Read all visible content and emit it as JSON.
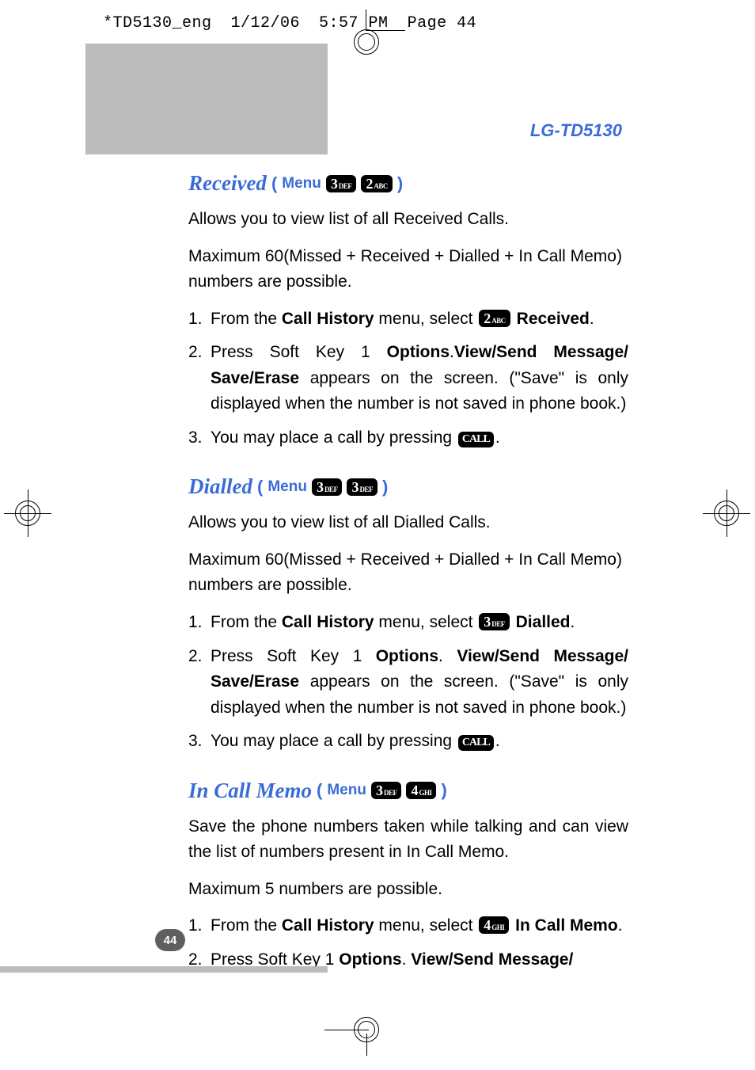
{
  "header": {
    "filename": "*TD5130_eng",
    "date": "1/12/06",
    "time": "5:57 PM",
    "page_label": "Page 44"
  },
  "product": "LG-TD5130",
  "keys": {
    "k2": {
      "num": "2",
      "sub": "ABC"
    },
    "k3": {
      "num": "3",
      "sub": "DEF"
    },
    "k4": {
      "num": "4",
      "sub": "GHI"
    },
    "call": "CALL"
  },
  "menu_word": "Menu",
  "sections": {
    "received": {
      "title": "Received",
      "intro1": "Allows you to view list of all Received Calls.",
      "intro2": "Maximum 60(Missed + Received + Dialled + In Call Memo) numbers are possible.",
      "s1_a": "From the ",
      "s1_b": "Call History",
      "s1_c": " menu, select ",
      "s1_d": "Received",
      "s2_a": "Press Soft Key 1 ",
      "s2_b": "Options",
      "s2_c": ".",
      "s2_d": "View/Send Message/ Save/Erase",
      "s2_e": " appears on the screen. (\"Save\" is only displayed when the number is not saved in phone book.)",
      "s3_a": "You may place a call by pressing ",
      "s3_b": "."
    },
    "dialled": {
      "title": "Dialled",
      "intro1": "Allows you to view list of all Dialled Calls.",
      "intro2": "Maximum 60(Missed + Received + Dialled + In Call Memo) numbers are possible.",
      "s1_a": "From the ",
      "s1_b": "Call History",
      "s1_c": " menu, select ",
      "s1_d": "Dialled",
      "s2_a": "Press Soft Key 1 ",
      "s2_b": "Options",
      "s2_c": ". ",
      "s2_d": "View/Send Message/ Save/Erase",
      "s2_e": " appears on the screen. (\"Save\" is only displayed when the number is not saved in phone book.)",
      "s3_a": "You may place a call by pressing ",
      "s3_b": "."
    },
    "memo": {
      "title": "In Call Memo",
      "intro1": "Save the phone numbers taken while talking and can view the list of numbers present in In Call Memo.",
      "intro2": "Maximum 5 numbers are possible.",
      "s1_a": "From the ",
      "s1_b": "Call History",
      "s1_c": " menu, select ",
      "s1_d": "In Call Memo",
      "s2_a": "Press Soft Key 1 ",
      "s2_b": "Options",
      "s2_c": ". ",
      "s2_d": "View/Send Message/"
    }
  },
  "page_number": "44"
}
